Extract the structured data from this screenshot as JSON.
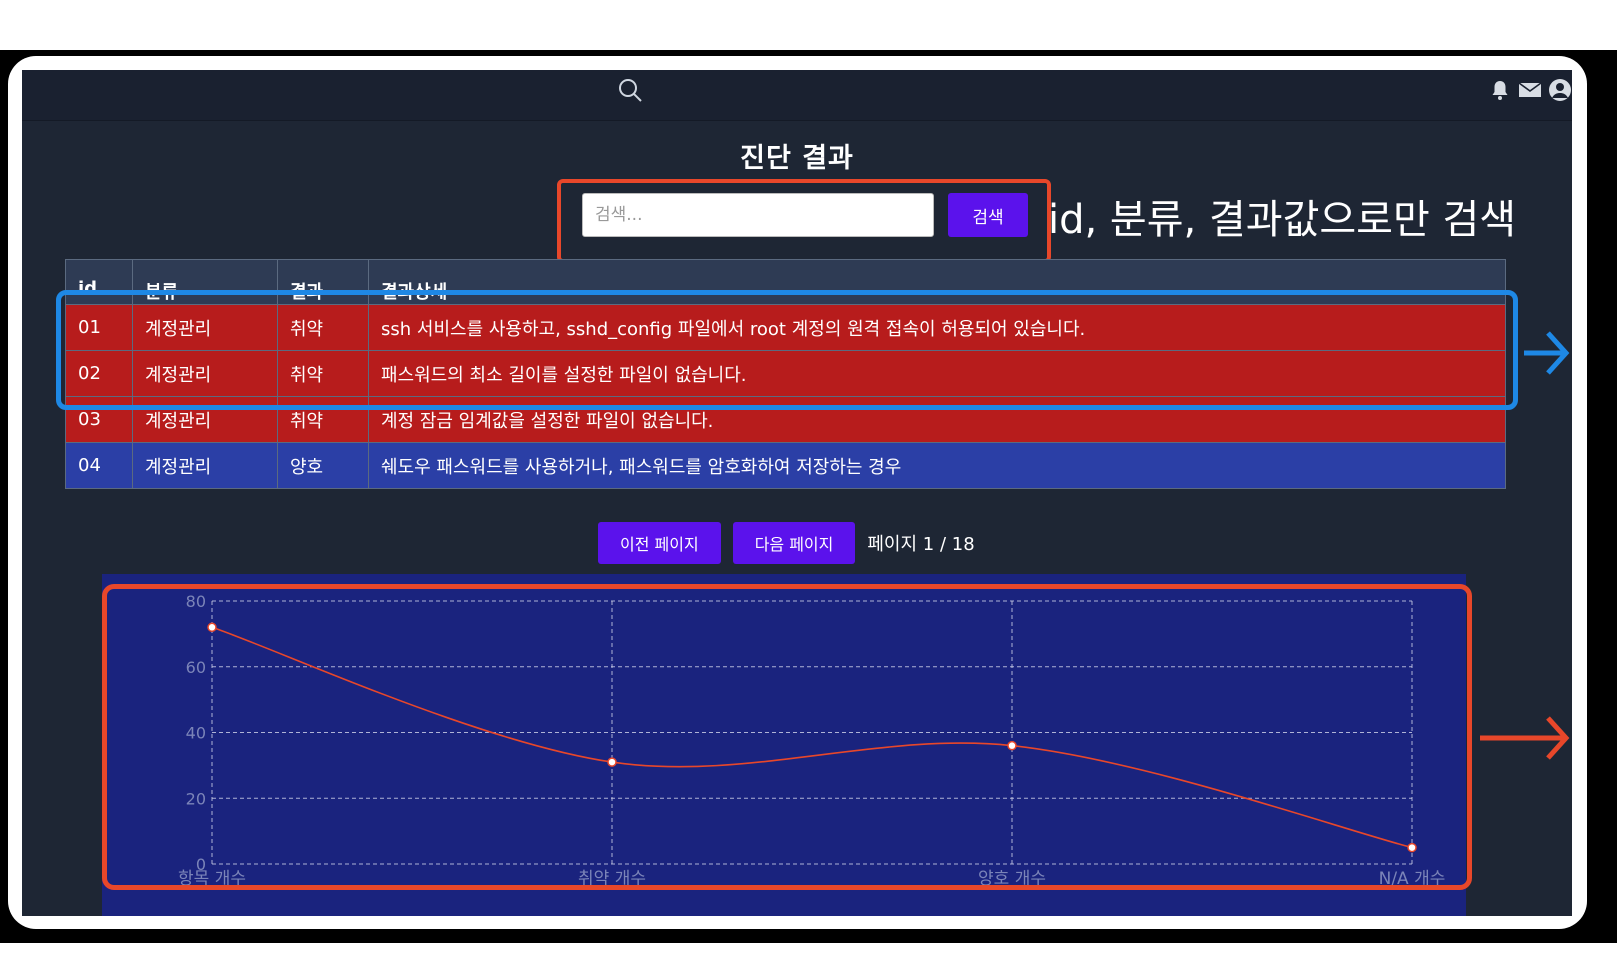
{
  "header": {
    "title": "진단 결과"
  },
  "search": {
    "placeholder": "검색...",
    "button_label": "검색"
  },
  "annotations": {
    "search_note": "id, 분류, 결과값으로만 검색",
    "highlight_color_search": "#e8472a",
    "highlight_color_rows": "#1e88e5"
  },
  "table": {
    "headers": [
      "id",
      "분류",
      "결과",
      "결과상세"
    ],
    "rows": [
      {
        "id": "01",
        "category": "계정관리",
        "result": "취약",
        "detail": "ssh 서비스를 사용하고, sshd_config 파일에서 root 계정의 원격 접속이 허용되어 있습니다.",
        "status_color": "#b71c1c"
      },
      {
        "id": "02",
        "category": "계정관리",
        "result": "취약",
        "detail": "패스워드의 최소 길이를 설정한 파일이 없습니다.",
        "status_color": "#b71c1c"
      },
      {
        "id": "03",
        "category": "계정관리",
        "result": "취약",
        "detail": "계정 잠금 임계값을 설정한 파일이 없습니다.",
        "status_color": "#b71c1c"
      },
      {
        "id": "04",
        "category": "계정관리",
        "result": "양호",
        "detail": "쉐도우 패스워드를 사용하거나, 패스워드를 암호화하여 저장하는 경우",
        "status_color": "#2b3fa6"
      }
    ]
  },
  "pager": {
    "prev_label": "이전 페이지",
    "next_label": "다음 페이지",
    "page_info": "페이지 1 / 18"
  },
  "icons": {
    "top_search": "search-icon",
    "bell": "bell-icon",
    "mail": "mail-icon",
    "user": "user-icon"
  },
  "chart_data": {
    "type": "line",
    "categories": [
      "항목 개수",
      "취약 개수",
      "양호 개수",
      "N/A 개수"
    ],
    "values": [
      72,
      31,
      36,
      5
    ],
    "ylim": [
      0,
      80
    ],
    "yticks": [
      0,
      20,
      40,
      60,
      80
    ],
    "grid": true,
    "line_color": "#e8472a",
    "background": "#1a237e"
  }
}
